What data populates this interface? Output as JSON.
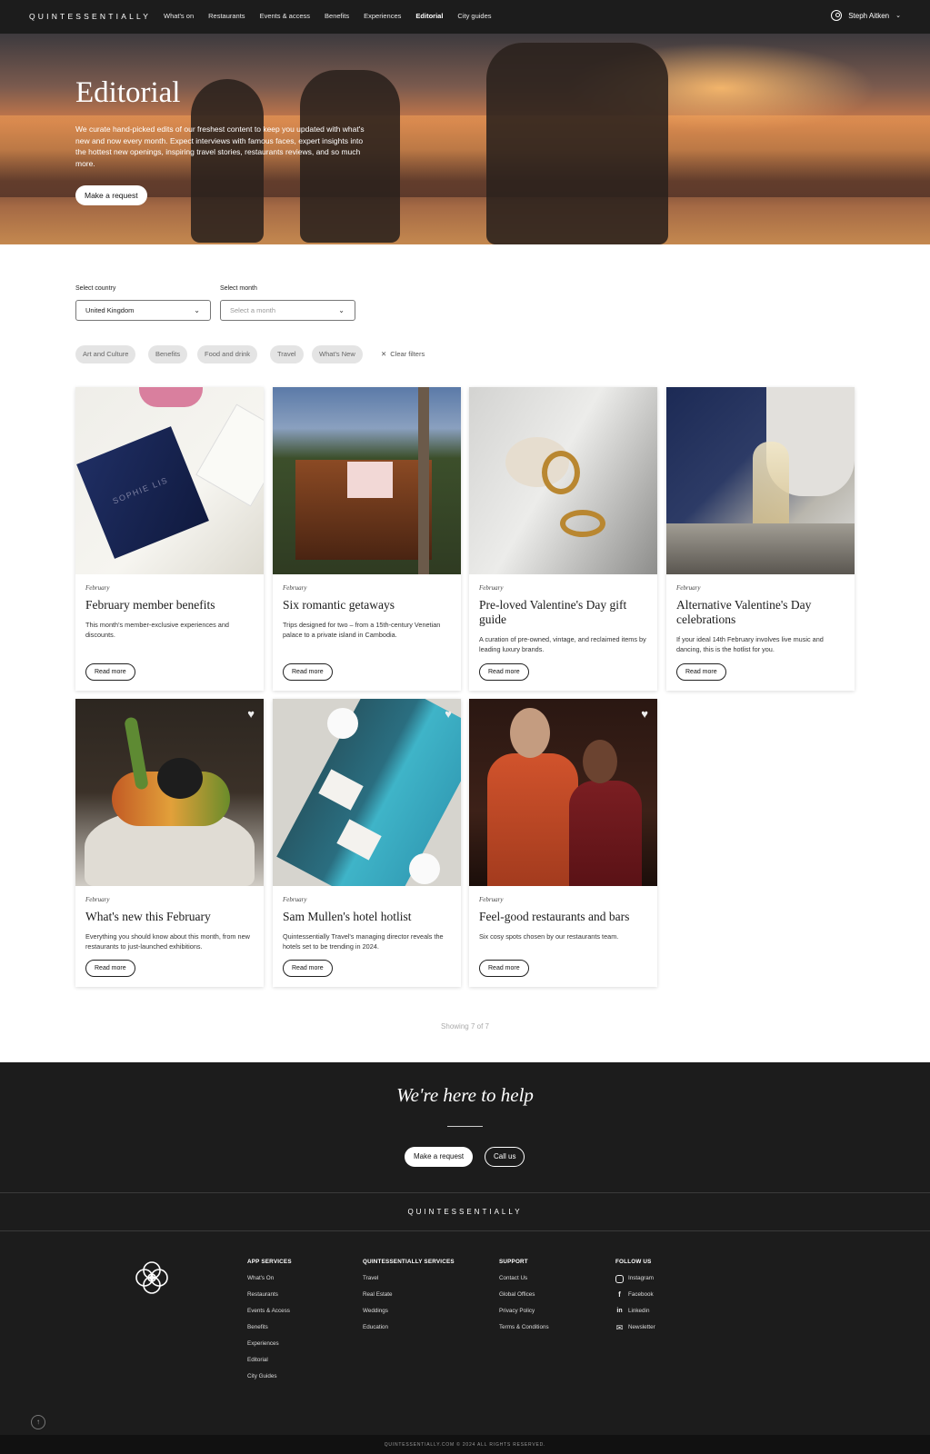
{
  "nav": {
    "brand": "QUINTESSENTIALLY",
    "links": [
      "What's on",
      "Restaurants",
      "Events & access",
      "Benefits",
      "Experiences",
      "Editorial",
      "City guides"
    ],
    "active": "Editorial",
    "user_name": "Steph Aitken"
  },
  "hero": {
    "title": "Editorial",
    "description": "We curate hand-picked edits of our freshest content to keep you updated with what's new and now every month. Expect interviews with famous faces, expert insights into the hottest new openings, inspiring travel stories, restaurants reviews, and so much more.",
    "button": "Make a request"
  },
  "filters": {
    "country_label": "Select country",
    "country_value": "United Kingdom",
    "month_label": "Select month",
    "month_placeholder": "Select a month",
    "chips": [
      "Art and Culture",
      "Benefits",
      "Food and drink",
      "Travel",
      "What's New"
    ],
    "clear": "Clear filters"
  },
  "cards": [
    {
      "month": "February",
      "title": "February member benefits",
      "desc": "This month's member-exclusive experiences and discounts.",
      "button": "Read more",
      "box_text": "SOPHIE LIS"
    },
    {
      "month": "February",
      "title": "Six romantic getaways",
      "desc": "Trips designed for two – from a 15th-century Venetian palace to a private island in Cambodia.",
      "button": "Read more"
    },
    {
      "month": "February",
      "title": "Pre-loved Valentine's Day gift guide",
      "desc": "A curation of pre-owned, vintage, and reclaimed items by leading luxury brands.",
      "button": "Read more"
    },
    {
      "month": "February",
      "title": "Alternative Valentine's Day celebrations",
      "desc": "If your ideal 14th February involves live music and dancing, this is the hotlist for you.",
      "button": "Read more"
    },
    {
      "month": "February",
      "title": "What's new this February",
      "desc": "Everything you should know about this month, from new restaurants to just-launched exhibitions.",
      "button": "Read more"
    },
    {
      "month": "February",
      "title": "Sam Mullen's hotel hotlist",
      "desc": "Quintessentially Travel's managing director reveals the hotels set to be trending in 2024.",
      "button": "Read more"
    },
    {
      "month": "February",
      "title": "Feel-good restaurants and bars",
      "desc": "Six cosy spots chosen by our restaurants team.",
      "button": "Read more"
    }
  ],
  "showing": "Showing 7 of 7",
  "help": {
    "title": "We're here to help",
    "request": "Make a request",
    "call": "Call us"
  },
  "footer": {
    "brand": "QUINTESSENTIALLY",
    "app_services": {
      "heading": "APP SERVICES",
      "links": [
        "What's On",
        "Restaurants",
        "Events & Access",
        "Benefits",
        "Experiences",
        "Editorial",
        "City Guides"
      ]
    },
    "q_services": {
      "heading": "QUINTESSENTIALLY SERVICES",
      "links": [
        "Travel",
        "Real Estate",
        "Weddings",
        "Education"
      ]
    },
    "support": {
      "heading": "SUPPORT",
      "links": [
        "Contact Us",
        "Global Offices",
        "Privacy Policy",
        "Terms & Conditions"
      ]
    },
    "follow": {
      "heading": "FOLLOW US",
      "links": [
        "Instagram",
        "Facebook",
        "Linkedin",
        "Newsletter"
      ]
    },
    "copyright": "QUINTESSENTIALLY.COM © 2024 ALL RIGHTS RESERVED."
  }
}
